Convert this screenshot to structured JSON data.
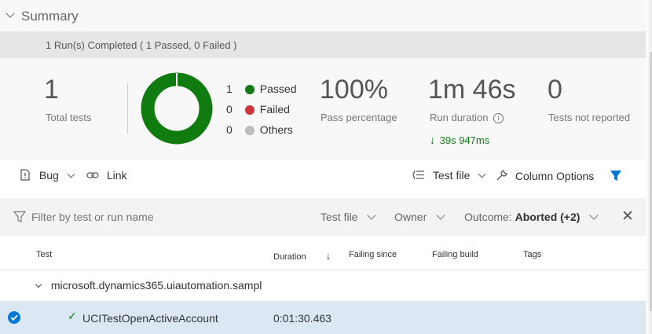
{
  "summary": {
    "title": "Summary",
    "runs_completed": "1 Run(s) Completed ( 1 Passed, 0 Failed )"
  },
  "stats": {
    "total_tests": "1",
    "total_tests_label": "Total tests",
    "legend": [
      {
        "count": "1",
        "label": "Passed",
        "color": "#107c10"
      },
      {
        "count": "0",
        "label": "Failed",
        "color": "#d13438"
      },
      {
        "count": "0",
        "label": "Others",
        "color": "#bdbdbd"
      }
    ],
    "pass_percentage": "100%",
    "pass_percentage_label": "Pass percentage",
    "run_duration": "1m 46s",
    "run_duration_label": "Run duration",
    "duration_delta": "39s 947ms",
    "not_reported": "0",
    "not_reported_label": "Tests not reported",
    "donut_color": "#107c10"
  },
  "toolbar": {
    "bug_label": "Bug",
    "link_label": "Link",
    "test_file_label": "Test file",
    "column_options_label": "Column Options",
    "accent": "#0078d4"
  },
  "filter": {
    "placeholder": "Filter by test or run name",
    "test_file": "Test file",
    "owner": "Owner",
    "outcome_label": "Outcome:",
    "outcome_value": "Aborted (+2)"
  },
  "table": {
    "columns": [
      "Test",
      "Duration",
      "Failing since",
      "Failing build",
      "Tags"
    ],
    "group_row": "microsoft.dynamics365.uiautomation.sampl",
    "rows": [
      {
        "test": "UCITestOpenActiveAccount",
        "duration": "0:01:30.463"
      }
    ]
  }
}
